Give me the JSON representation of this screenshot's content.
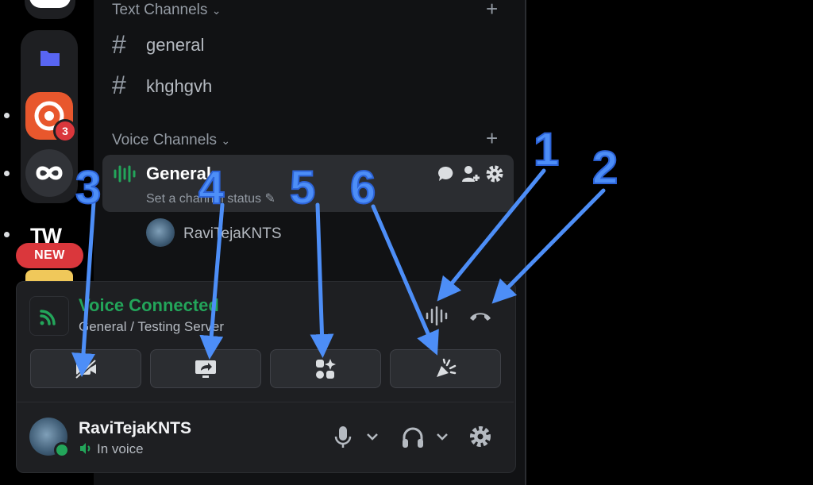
{
  "sidebar": {
    "text_category": "Text Channels",
    "text_channels": [
      "general",
      "khghgvh"
    ],
    "voice_category": "Voice Channels",
    "voice_channel": {
      "name": "General",
      "status_placeholder": "Set a channel status"
    },
    "voice_member": "RaviTejaKNTS"
  },
  "rail": {
    "notification_count": "3",
    "new_label": "NEW",
    "tw_label": "TW"
  },
  "voice_panel": {
    "title": "Voice Connected",
    "subtitle": "General / Testing Server",
    "buttons": [
      "camera-off",
      "screen-share",
      "activities",
      "soundboard"
    ]
  },
  "user": {
    "name": "RaviTejaKNTS",
    "status": "In voice"
  },
  "annotations": [
    "1",
    "2",
    "3",
    "4",
    "5",
    "6"
  ],
  "colors": {
    "accent_blue": "#4d8ef7",
    "connected_green": "#23a55a",
    "badge_red": "#da373c"
  }
}
